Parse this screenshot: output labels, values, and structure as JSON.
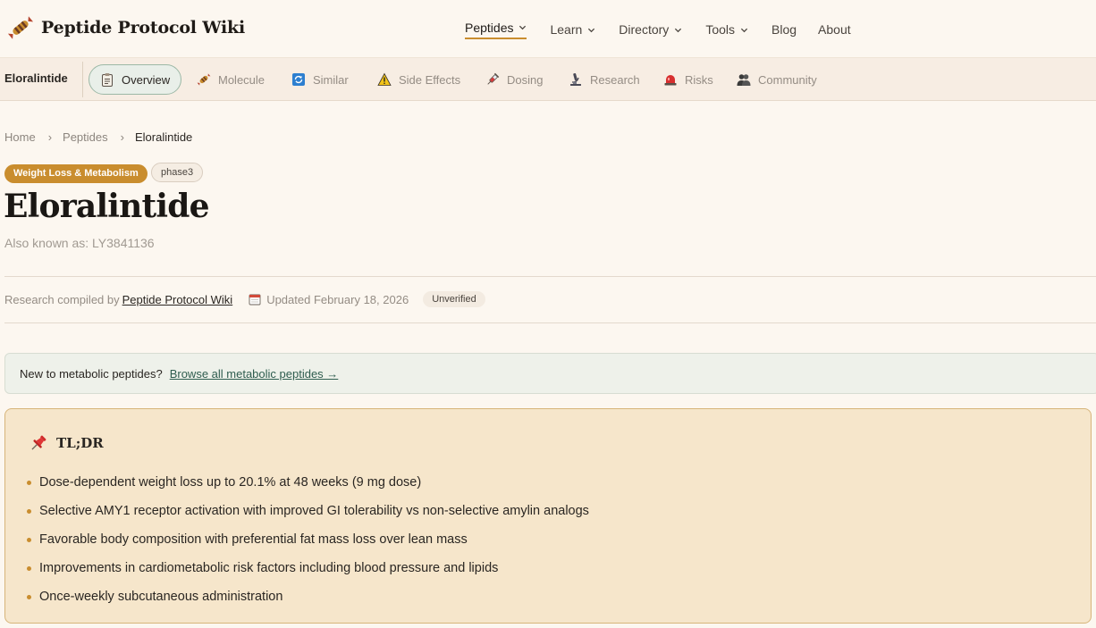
{
  "header": {
    "brand": "Peptide Protocol Wiki",
    "nav": [
      {
        "label": "Peptides",
        "has_menu": true,
        "active": true
      },
      {
        "label": "Learn",
        "has_menu": true
      },
      {
        "label": "Directory",
        "has_menu": true
      },
      {
        "label": "Tools",
        "has_menu": true
      },
      {
        "label": "Blog",
        "has_menu": false
      },
      {
        "label": "About",
        "has_menu": false
      }
    ]
  },
  "subnav": {
    "page_label": "Eloralintide",
    "tabs": [
      {
        "label": "Overview",
        "icon": "clipboard-icon",
        "active": true
      },
      {
        "label": "Molecule",
        "icon": "candy-molecule-icon"
      },
      {
        "label": "Similar",
        "icon": "refresh-icon"
      },
      {
        "label": "Side Effects",
        "icon": "warning-icon"
      },
      {
        "label": "Dosing",
        "icon": "syringe-icon"
      },
      {
        "label": "Research",
        "icon": "microscope-icon"
      },
      {
        "label": "Risks",
        "icon": "siren-icon"
      },
      {
        "label": "Community",
        "icon": "people-icon"
      }
    ]
  },
  "breadcrumb": {
    "items": [
      "Home",
      "Peptides"
    ],
    "current": "Eloralintide"
  },
  "peptide": {
    "category": "Weight Loss & Metabolism",
    "phase": "phase3",
    "name": "Eloralintide",
    "aka": "Also known as: LY3841136",
    "compiled_prefix": "Research compiled by",
    "compiled_by": "Peptide Protocol Wiki",
    "updated": "Updated February 18, 2026",
    "status": "Unverified"
  },
  "banner": {
    "text": "New to metabolic peptides?",
    "link": "Browse all metabolic peptides →"
  },
  "tldr": {
    "title": "TL;DR",
    "items": [
      "Dose-dependent weight loss up to 20.1% at 48 weeks (9 mg dose)",
      "Selective AMY1 receptor activation with improved GI tolerability vs non-selective amylin analogs",
      "Favorable body composition with preferential fat mass loss over lean mass",
      "Improvements in cardiometabolic risk factors including blood pressure and lipids",
      "Once-weekly subcutaneous administration"
    ]
  },
  "colors": {
    "accent": "#c98d2e",
    "background": "#fcf7f0",
    "tldr_bg": "#f6e6cb",
    "link_green": "#2f5d4f"
  }
}
